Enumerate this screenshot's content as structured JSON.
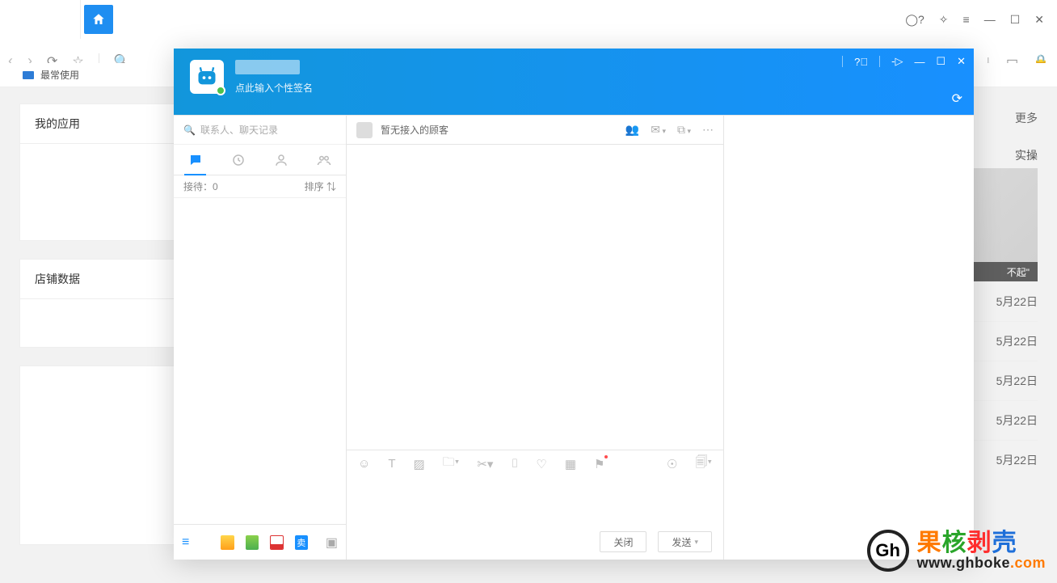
{
  "browser": {
    "bookmark_label": "最常使用",
    "win_icons": [
      "help",
      "puzzle",
      "menu",
      "min",
      "max",
      "close"
    ]
  },
  "bg": {
    "left_cards": [
      "我的应用",
      "店铺数据"
    ],
    "right_more": "更多",
    "right_caption": "实操",
    "thumb_overlay": "不起\"",
    "dates": [
      "5月22日",
      "5月22日",
      "5月22日",
      "5月22日",
      "5月22日"
    ]
  },
  "chat": {
    "signature_placeholder": "点此输入个性签名",
    "search_placeholder": "联系人、聊天记录",
    "waiting_label": "接待：",
    "waiting_count": "0",
    "sort_label": "排序",
    "no_customer": "暂无接入的顾客",
    "close_btn": "关闭",
    "send_btn": "发送"
  },
  "watermark": {
    "cn": [
      "果",
      "核",
      "剥",
      "壳"
    ],
    "url_prefix": "www.ghboke",
    "url_suffix": ".com"
  }
}
